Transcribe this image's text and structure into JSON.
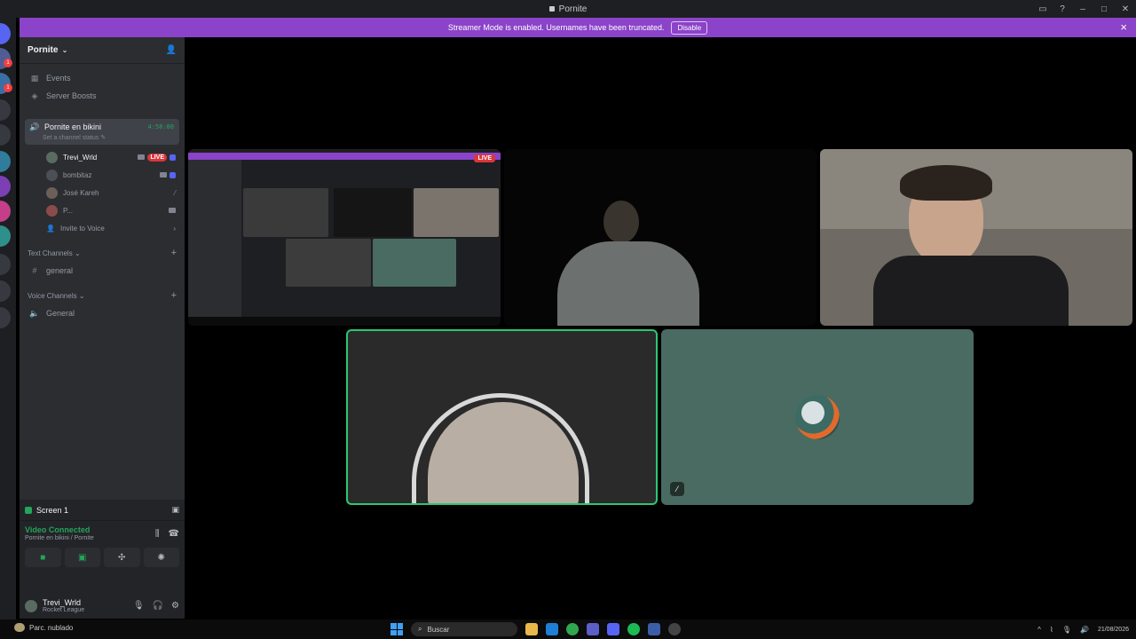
{
  "window": {
    "title": "Pornite"
  },
  "banner": {
    "text": "Streamer Mode is enabled. Usernames have been truncated.",
    "disable_label": "Disable"
  },
  "server": {
    "name": "Pornite"
  },
  "sidebar": {
    "events_label": "Events",
    "boosts_label": "Server Boosts",
    "voice_channel": {
      "name": "Pornite en bikini",
      "timer": "4:58:80",
      "status_placeholder": "Set a channel status"
    },
    "members": [
      {
        "name": "Trevi_Wrld",
        "live_label": "LIVE"
      },
      {
        "name": "bombitaz"
      },
      {
        "name": "José Kareh"
      },
      {
        "name": "P..."
      }
    ],
    "invite_label": "Invite to Voice",
    "text_channels_header": "Text Channels",
    "text_channels": [
      {
        "name": "general"
      }
    ],
    "voice_channels_header": "Voice Channels",
    "voice_channels": [
      {
        "name": "General"
      }
    ]
  },
  "user_panel": {
    "screen_label": "Screen 1",
    "connection_title": "Video Connected",
    "connection_sub": "Pornite en bikini / Pornite",
    "username": "Trevi_Wrld",
    "status": "Rocket League"
  },
  "stream": {
    "live_label": "LIVE"
  },
  "taskbar": {
    "weather": "Parc. nublado",
    "search_placeholder": "Buscar",
    "date": "21/08/2026"
  },
  "colors": {
    "banner": "#8b43c9",
    "speaking_border": "#2dc770",
    "live": "#da373c",
    "connected": "#23a55a"
  }
}
